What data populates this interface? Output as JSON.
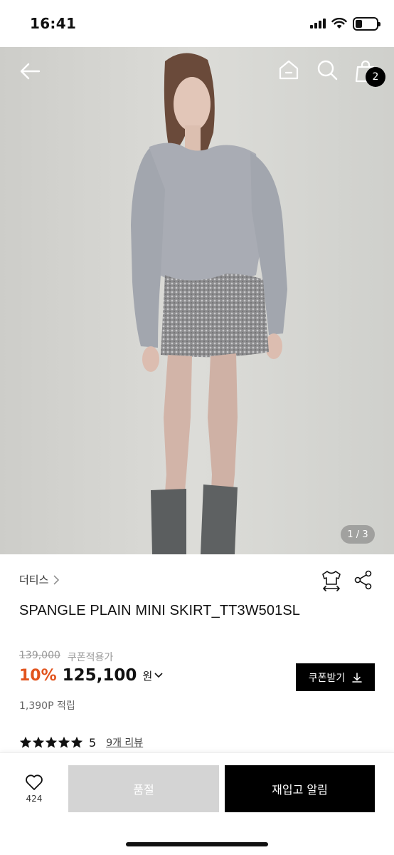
{
  "status_bar": {
    "time": "16:41",
    "battery_level": 0.25
  },
  "header": {
    "back_icon": "arrow-left-icon",
    "home_icon": "home-icon",
    "search_icon": "search-icon",
    "cart_icon": "shopping-bag-icon",
    "cart_count": "2"
  },
  "hero": {
    "image_counter": "1 / 3"
  },
  "product": {
    "brand": "더티스",
    "name": "SPANGLE PLAIN MINI SKIRT_TT3W501SL",
    "original_price": "139,000",
    "coupon_note": "쿠폰적용가",
    "discount": "10%",
    "sale_price": "125,100",
    "currency": "원",
    "coupon_button": "쿠폰받기",
    "points": "1,390P 적립",
    "rating": "5",
    "rating_stars": 5,
    "review_link": "9개 리뷰"
  },
  "bottom_bar": {
    "like_count": "424",
    "soldout_label": "품절",
    "restock_label": "재입고 알림"
  },
  "colors": {
    "accent": "#e2541e",
    "primary_button": "#000000",
    "disabled_button": "#d4d4d4"
  }
}
